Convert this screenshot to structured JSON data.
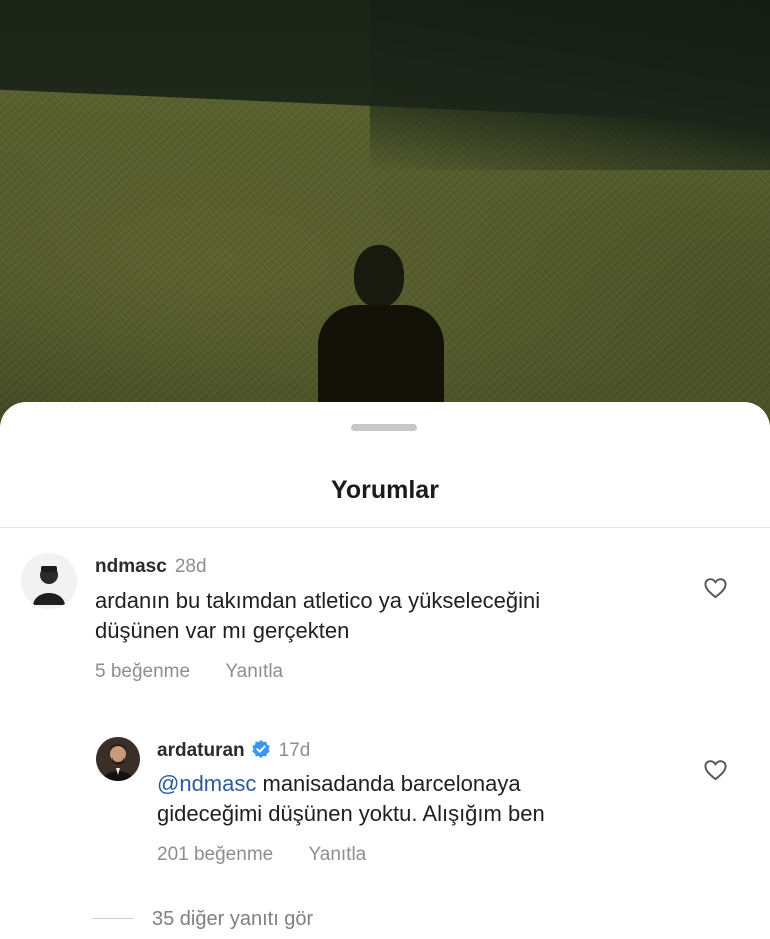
{
  "sheet": {
    "title": "Yorumlar"
  },
  "comments": [
    {
      "username": "ndmasc",
      "time": "28d",
      "text": "ardanın bu takımdan atletico ya yükseleceğini düşünen var mı gerçekten",
      "text_line1": "ardanın bu takımdan atletico ya yükseleceğini",
      "text_line2": "düşünen var mı gerçekten",
      "likes": "5 beğenme",
      "reply_label": "Yanıtla",
      "icon": "heart-outline-icon"
    }
  ],
  "reply": {
    "username": "ardaturan",
    "verified": true,
    "time": "17d",
    "mention": "@ndmasc",
    "text_line1": "manisadanda barcelonaya",
    "text_line2": "gideceğimi düşünen yoktu. Alışığım ben",
    "likes": "201 beğenme",
    "reply_label": "Yanıtla",
    "icon": "heart-outline-icon",
    "verified_color": "#3897f0"
  },
  "more_replies": {
    "label": "35 diğer yanıtı gör"
  },
  "colors": {
    "mention": "#2d5b99",
    "muted": "#8e8e8e"
  }
}
